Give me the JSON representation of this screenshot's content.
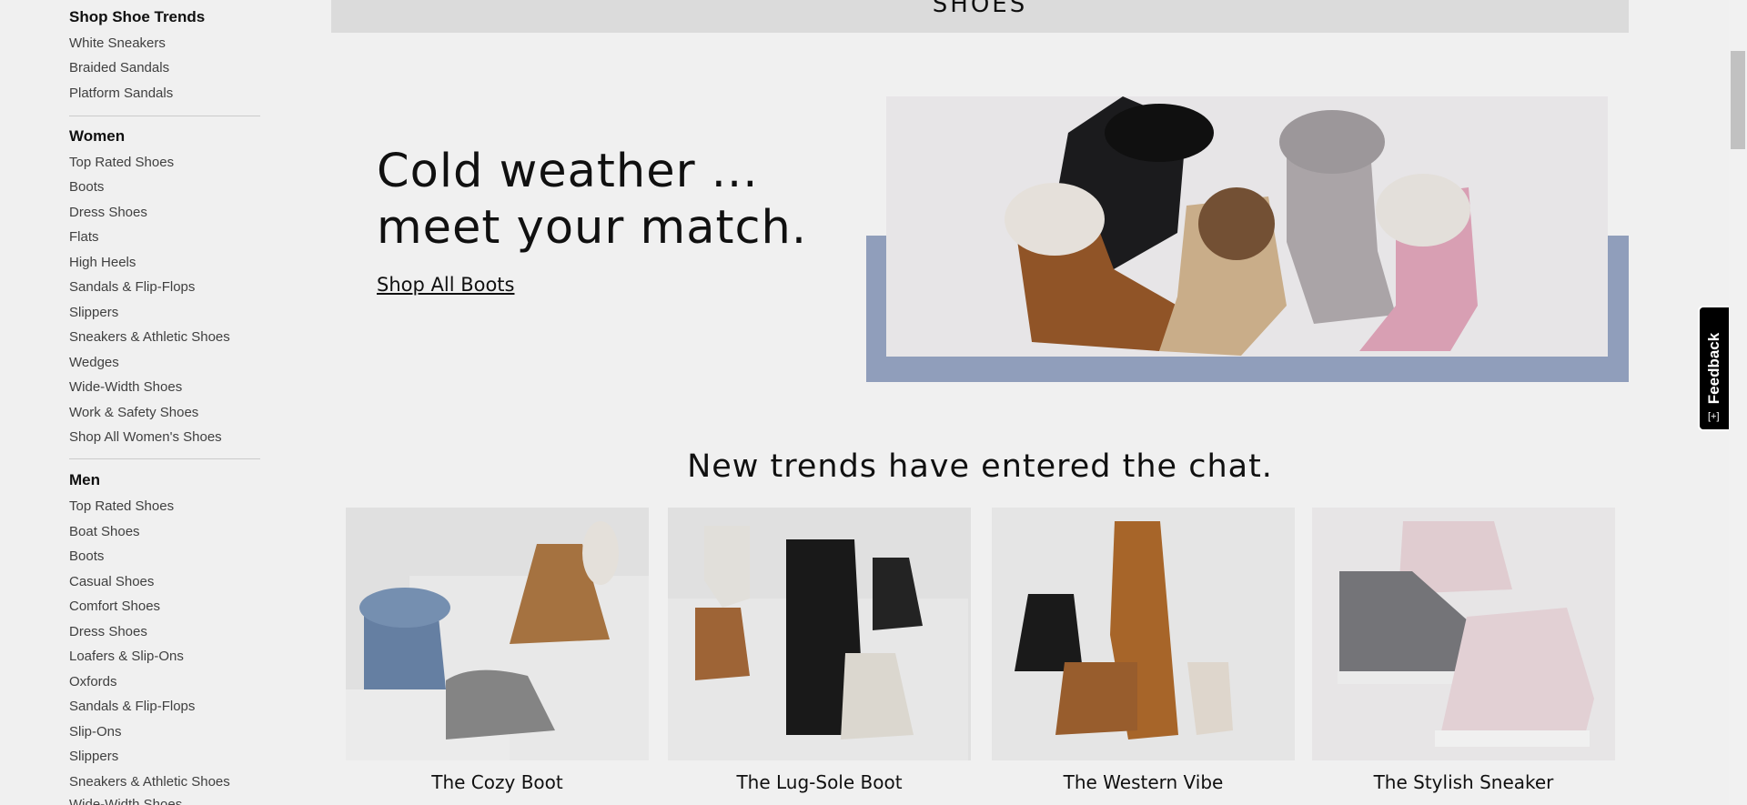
{
  "sidebar": {
    "trends": {
      "heading": "Shop Shoe Trends",
      "items": [
        "White Sneakers",
        "Braided Sandals",
        "Platform Sandals"
      ]
    },
    "women": {
      "heading": "Women",
      "items": [
        "Top Rated Shoes",
        "Boots",
        "Dress Shoes",
        "Flats",
        "High Heels",
        "Sandals & Flip-Flops",
        "Slippers",
        "Sneakers & Athletic Shoes",
        "Wedges",
        "Wide-Width Shoes",
        "Work & Safety Shoes",
        "Shop All Women's Shoes"
      ]
    },
    "men": {
      "heading": "Men",
      "items": [
        "Top Rated Shoes",
        "Boat Shoes",
        "Boots",
        "Casual Shoes",
        "Comfort Shoes",
        "Dress Shoes",
        "Loafers & Slip-Ons",
        "Oxfords",
        "Sandals & Flip-Flops",
        "Slip-Ons",
        "Slippers",
        "Sneakers & Athletic Shoes",
        "Wide-Width Shoes"
      ]
    }
  },
  "main": {
    "page_title": "SHOES",
    "hero": {
      "title_line1": "Cold weather ...",
      "title_line2": "meet your match.",
      "link": "Shop All Boots"
    },
    "section_title": "New trends have entered the chat.",
    "cards": [
      {
        "label": "The Cozy Boot"
      },
      {
        "label": "The Lug-Sole Boot"
      },
      {
        "label": "The Western Vibe"
      },
      {
        "label": "The Stylish Sneaker"
      }
    ]
  },
  "feedback": {
    "label": "Feedback",
    "icon": "feedback-icon"
  },
  "colors": {
    "hero_frame": "#9aa8c7",
    "feedback_bg": "#000000"
  }
}
